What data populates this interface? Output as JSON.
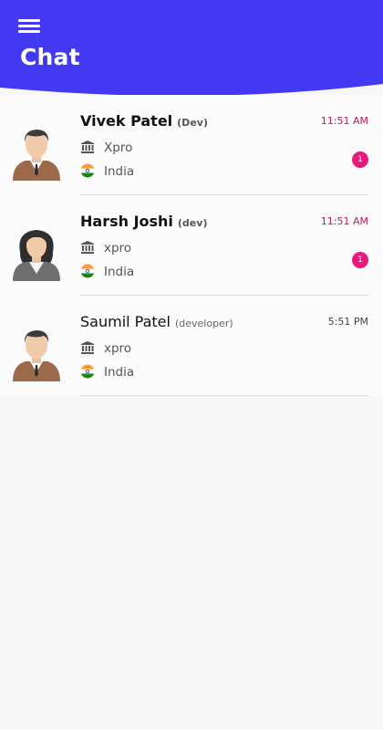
{
  "colors": {
    "header": "#4339f2",
    "unread_time": "#c2185b",
    "badge": "#e8197a"
  },
  "header": {
    "menu_icon": "menu-icon",
    "title": "Chat"
  },
  "chats": [
    {
      "name": "Vivek Patel",
      "role": "(Dev)",
      "time": "11:51 AM",
      "company": "Xpro",
      "country": "India",
      "unread": "1",
      "avatar": "male-avatar"
    },
    {
      "name": "Harsh Joshi",
      "role": "(dev)",
      "time": "11:51 AM",
      "company": "xpro",
      "country": "India",
      "unread": "1",
      "avatar": "female-avatar"
    },
    {
      "name": "Saumil Patel",
      "role": "(developer)",
      "time": "5:51 PM",
      "company": "xpro",
      "country": "India",
      "unread": "",
      "avatar": "male-avatar"
    }
  ]
}
